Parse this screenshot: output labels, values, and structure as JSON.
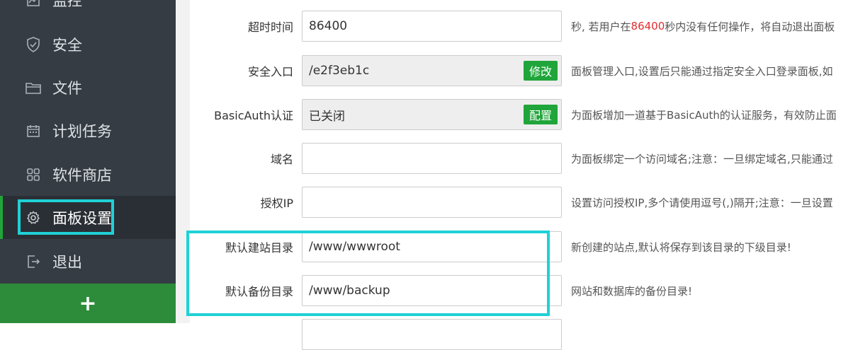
{
  "sidebar": {
    "items": [
      {
        "label": "监控",
        "icon": "monitor-icon"
      },
      {
        "label": "安全",
        "icon": "shield-icon"
      },
      {
        "label": "文件",
        "icon": "folder-icon"
      },
      {
        "label": "计划任务",
        "icon": "calendar-icon"
      },
      {
        "label": "软件商店",
        "icon": "grid-icon"
      },
      {
        "label": "面板设置",
        "icon": "gear-icon"
      },
      {
        "label": "退出",
        "icon": "logout-icon"
      }
    ],
    "add_label": "+"
  },
  "form": {
    "timeout": {
      "label": "超时时间",
      "value": "86400",
      "hint_pre": "秒, 若用户在",
      "hint_red": "86400",
      "hint_post": "秒内没有任何操作，将自动退出面板"
    },
    "entry": {
      "label": "安全入口",
      "value": "/e2f3eb1c",
      "button": "修改",
      "hint": "面板管理入口,设置后只能通过指定安全入口登录面板,如"
    },
    "basicauth": {
      "label": "BasicAuth认证",
      "value": "已关闭",
      "button": "配置",
      "hint": "为面板增加一道基于BasicAuth的认证服务，有效防止面"
    },
    "domain": {
      "label": "域名",
      "value": "",
      "hint": "为面板绑定一个访问域名;注意：一旦绑定域名,只能通过"
    },
    "auth_ip": {
      "label": "授权IP",
      "value": "",
      "hint": "设置访问授权IP,多个请使用逗号(,)隔开;注意：一旦设置"
    },
    "site_dir": {
      "label": "默认建站目录",
      "value": "/www/wwwroot",
      "hint": "新创建的站点,默认将保存到该目录的下级目录!"
    },
    "backup_dir": {
      "label": "默认备份目录",
      "value": "/www/backup",
      "hint": "网站和数据库的备份目录!"
    }
  }
}
